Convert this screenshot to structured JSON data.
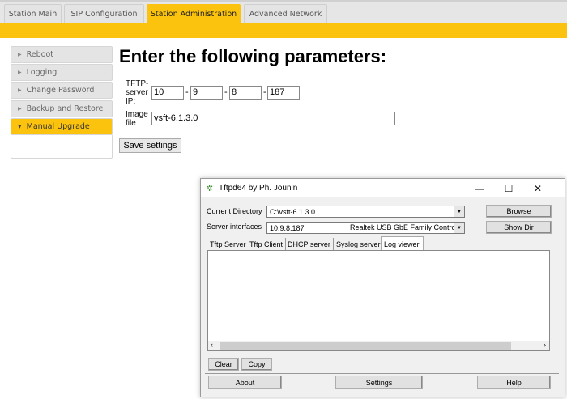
{
  "tabs": [
    {
      "label": "Station Main"
    },
    {
      "label": "SIP Configuration"
    },
    {
      "label": "Station Administration"
    },
    {
      "label": "Advanced Network"
    }
  ],
  "sidebar": {
    "items": [
      {
        "label": "Reboot"
      },
      {
        "label": "Logging"
      },
      {
        "label": "Change Password"
      },
      {
        "label": "Backup and Restore"
      },
      {
        "label": "Manual Upgrade"
      }
    ]
  },
  "main": {
    "title": "Enter the following parameters:",
    "tftp_label_1": "TFTP-",
    "tftp_label_2": "server",
    "tftp_label_3": "IP:",
    "ip": [
      "10",
      "9",
      "8",
      "187"
    ],
    "sep": "-",
    "image_label_1": "Image",
    "image_label_2": "file",
    "image_value": "vsft-6.1.3.0",
    "save_label": "Save settings"
  },
  "colors": {
    "accent": "#fcc30e"
  },
  "tftpd": {
    "title": "Tftpd64 by Ph. Jounin",
    "minimize": "—",
    "maximize": "☐",
    "close": "✕",
    "current_dir_label": "Current Directory",
    "current_dir_value": "C:\\vsft-6.1.3.0",
    "server_if_label": "Server interfaces",
    "server_if_ip": "10.9.8.187",
    "server_if_name": "Realtek USB GbE Family Controller",
    "browse": "Browse",
    "show_dir": "Show Dir",
    "tabs": [
      "Tftp Server",
      "Tftp Client",
      "DHCP server",
      "Syslog server",
      "Log viewer"
    ],
    "clear": "Clear",
    "copy": "Copy",
    "about": "About",
    "settings": "Settings",
    "help": "Help"
  }
}
